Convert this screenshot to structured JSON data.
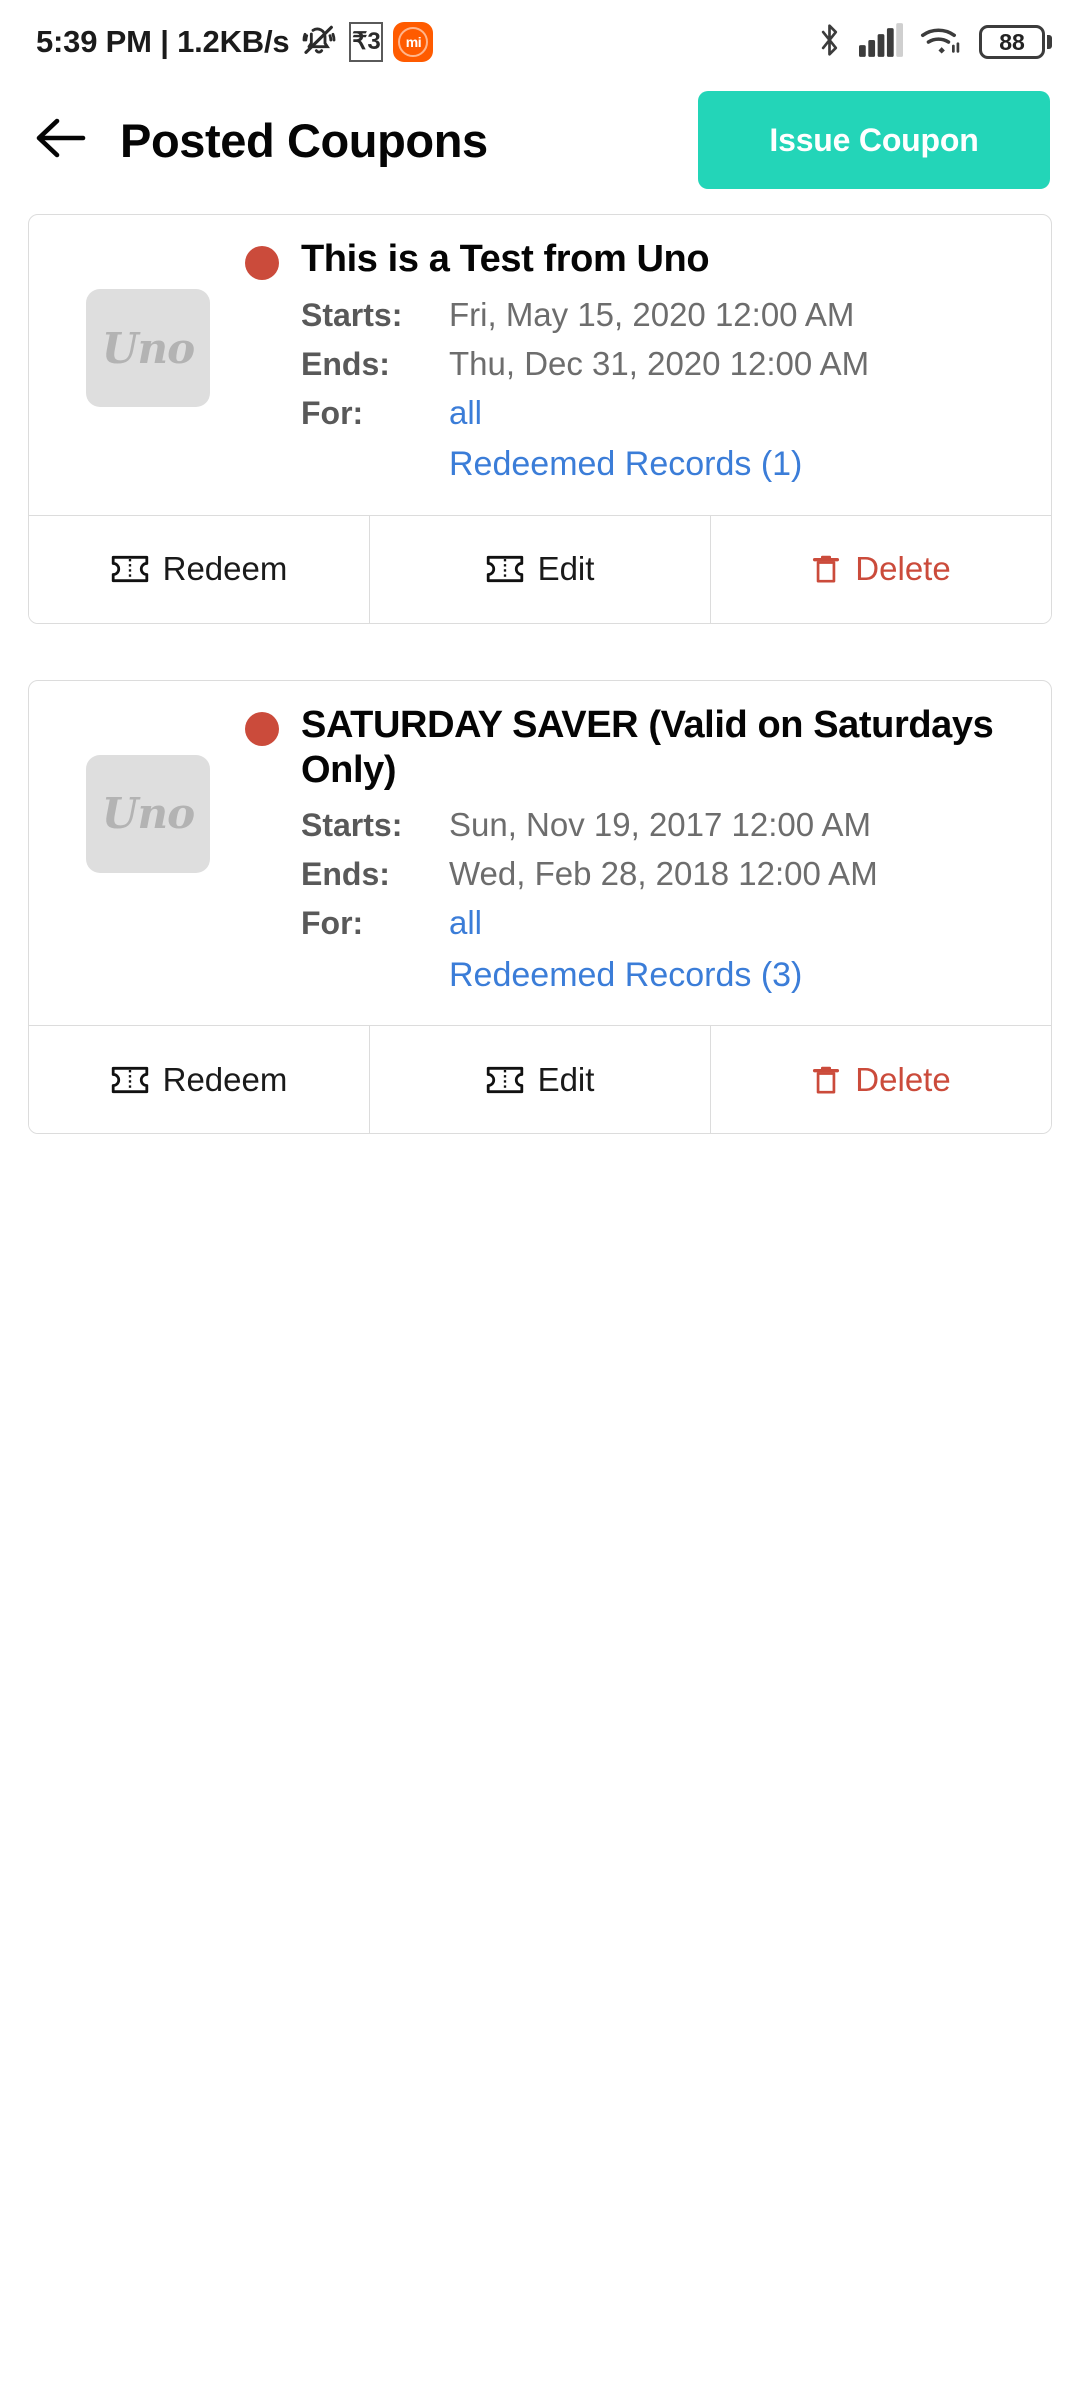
{
  "status_bar": {
    "time": "5:39 PM",
    "separator": "|",
    "network_speed": "1.2KB/s",
    "bell_icon": "bell-muted-icon",
    "rupee_badge": "₹3",
    "mi_badge": "mi",
    "bluetooth_icon": "bluetooth-icon",
    "signal_icon": "cellular-signal-icon",
    "wifi_icon": "wifi-icon",
    "battery_level": "88"
  },
  "header": {
    "back_icon": "arrow-left-icon",
    "title": "Posted Coupons",
    "issue_button": "Issue Coupon",
    "accent_color": "#23D5B8"
  },
  "labels": {
    "starts": "Starts:",
    "ends": "Ends:",
    "for": "For:"
  },
  "actions": {
    "redeem": "Redeem",
    "edit": "Edit",
    "delete": "Delete",
    "redeem_icon": "ticket-icon",
    "edit_icon": "ticket-icon",
    "delete_icon": "trash-icon",
    "danger_color": "#CB4B3B"
  },
  "coupons": [
    {
      "logo_text": "Uno",
      "status_dot_color": "#CB4B3B",
      "title": "This is a Test from Uno",
      "starts": "Fri, May 15, 2020 12:00 AM",
      "ends": "Thu, Dec 31, 2020 12:00 AM",
      "for": "all",
      "redeemed_records": "Redeemed Records (1)"
    },
    {
      "logo_text": "Uno",
      "status_dot_color": "#CB4B3B",
      "title": "SATURDAY SAVER (Valid on Saturdays Only)",
      "starts": "Sun, Nov 19, 2017 12:00 AM",
      "ends": "Wed, Feb 28, 2018 12:00 AM",
      "for": "all",
      "redeemed_records": "Redeemed Records (3)"
    }
  ]
}
